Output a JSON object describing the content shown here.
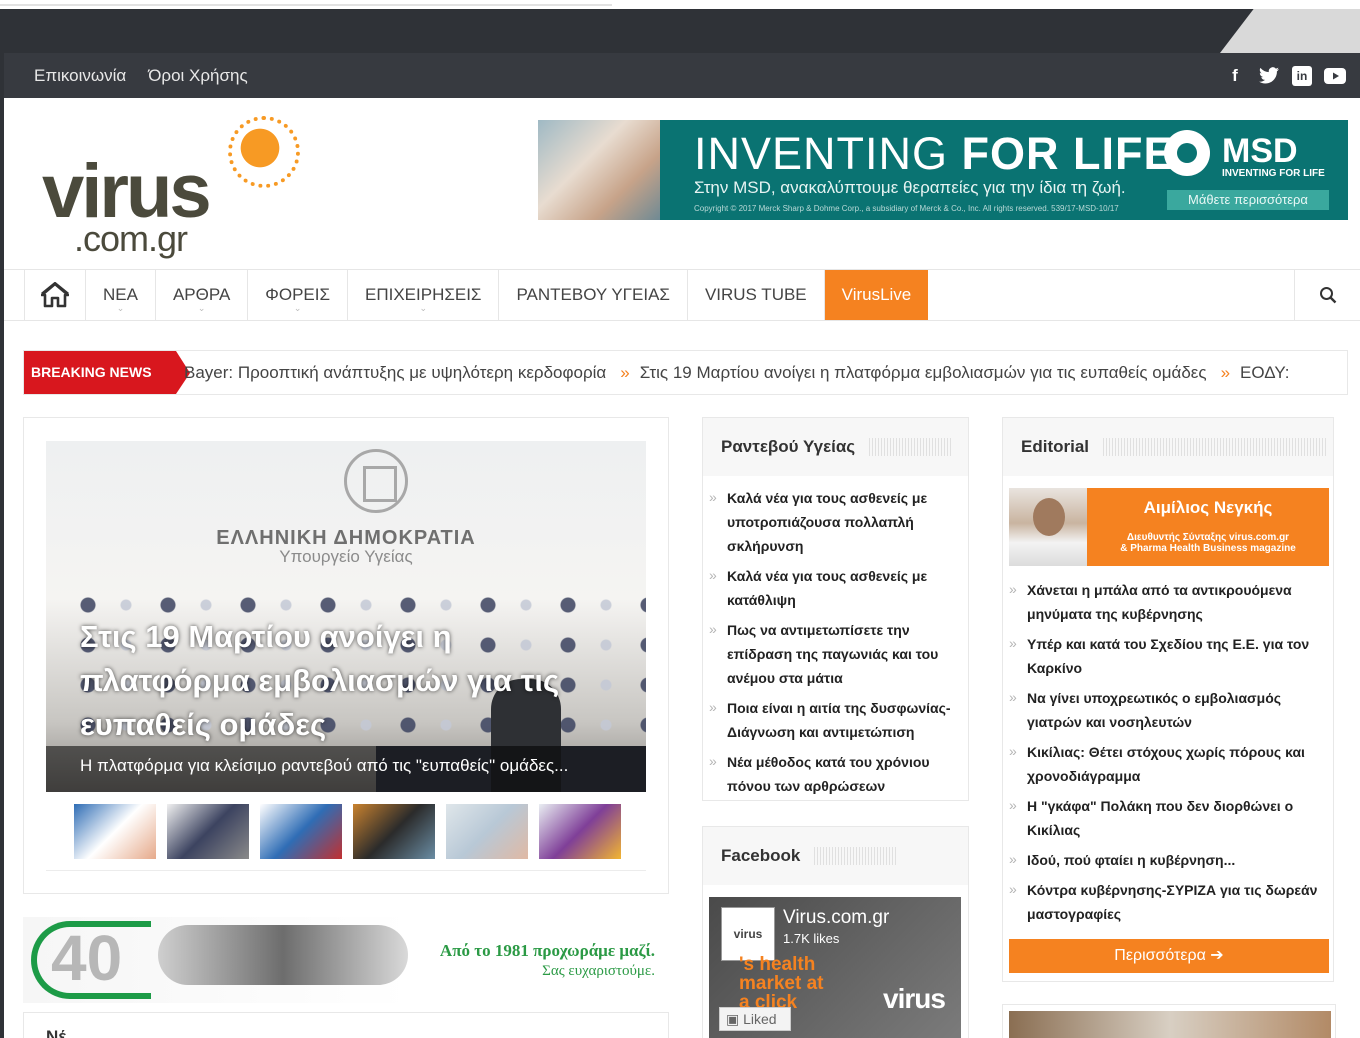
{
  "topbar": {
    "links": [
      "Επικοινωνία",
      "Όροι Χρήσης"
    ],
    "social_icons": [
      "facebook-icon",
      "twitter-icon",
      "linkedin-icon",
      "youtube-icon"
    ]
  },
  "logo": {
    "word": "virus",
    "domain": ".com.gr"
  },
  "banner": {
    "title_light": "INVENTING ",
    "title_bold": "FOR LIFE",
    "subtitle": "Στην MSD, ανακαλύπτουμε θεραπείες για την ίδια τη ζωή.",
    "copyright": "Copyright © 2017 Merck Sharp & Dohme Corp., a subsidiary of Merck & Co., Inc. All rights reserved. 539/17-MSD-10/17",
    "brand": "MSD",
    "brand_tag": "INVENTING FOR LIFE",
    "button": "Μάθετε περισσότερα"
  },
  "nav": {
    "items": [
      "ΝΕΑ",
      "ΑΡΘΡΑ",
      "ΦΟΡΕΙΣ",
      "ΕΠΙΧΕΙΡΗΣΕΙΣ",
      "ΡΑΝΤΕΒΟΥ ΥΓΕΙΑΣ",
      "VIRUS TUBE"
    ],
    "live": "VirusLive"
  },
  "breaking": {
    "label": "BREAKING NEWS",
    "items": [
      "Bayer: Προοπτική ανάπτυξης με υψηλότερη κερδοφορία",
      "Στις 19 Μαρτίου ανοίγει η πλατφόρμα εμβολιασμών για τις ευπαθείς ομάδες",
      "ΕΟΔΥ:"
    ]
  },
  "featured": {
    "image_text_line1": "ΕΛΛΗΝΙΚΗ ΔΗΜΟΚΡΑΤΙΑ",
    "image_text_line2": "Υπουργείο Υγείας",
    "headline": "Στις 19 Μαρτίου ανοίγει η πλατφόρμα εμβολιασμών για τις ευπαθείς ομάδες",
    "caption": "Η πλατφόρμα για κλείσιμο ραντεβού από τις \"ευπαθείς\" ομάδες..."
  },
  "thumbnails": [
    {
      "name": "thumb-greek-flag-vaccine",
      "colors": [
        "#2f6db5",
        "#ffffff",
        "#e6a98a"
      ]
    },
    {
      "name": "thumb-press-conference",
      "colors": [
        "#f0f0f0",
        "#3c4360",
        "#8a8a8a"
      ]
    },
    {
      "name": "thumb-greek-globe-vaccine",
      "colors": [
        "#ffffff",
        "#2f6db5",
        "#c23030"
      ]
    },
    {
      "name": "thumb-vaccine-vials",
      "colors": [
        "#c9822f",
        "#2b2b2b",
        "#6a8da4"
      ]
    },
    {
      "name": "thumb-vaccination",
      "colors": [
        "#dfe6ea",
        "#b8c8d6",
        "#e0b9a4"
      ]
    },
    {
      "name": "thumb-astrazeneca",
      "colors": [
        "#e9eef2",
        "#7f3f98",
        "#f2b531"
      ]
    }
  ],
  "promo40": {
    "number": "40",
    "line1": "Από το 1981 προχωράμε μαζί.",
    "line2": "Σας ευχαριστούμε."
  },
  "lower_stub_title": "Νέ",
  "appointments": {
    "title": "Ραντεβού Υγείας",
    "items": [
      "Καλά νέα για τους ασθενείς με υποτροπιάζουσα πολλαπλή σκλήρυνση",
      "Καλά νέα για τους ασθενείς με κατάθλιψη",
      "Πως να αντιμετωπίσετε την επίδραση της παγωνιάς και του ανέμου στα μάτια",
      "Ποια είναι η αιτία της δυσφωνίας- Διάγνωση και αντιμετώπιση",
      "Νέα μέθοδος κατά του χρόνιου πόνου των αρθρώσεων"
    ]
  },
  "facebook": {
    "title": "Facebook",
    "page_name": "Virus.com.gr",
    "likes": "1.7K likes",
    "avatar_text": "virus",
    "slogan": "'s health market at a click ouse!",
    "logo_text": "virus",
    "liked_button": "Liked"
  },
  "editorial": {
    "title": "Editorial",
    "author": "Αιμίλιος Νεγκής",
    "role_line1": "Διευθυντής Σύνταξης virus.com.gr",
    "role_line2": "& Pharma Health Business magazine",
    "items": [
      "Χάνεται η μπάλα από τα αντικρουόμενα μηνύματα της κυβέρνησης",
      "Υπέρ και κατά του Σχεδίου της Ε.Ε. για τον Καρκίνο",
      "Να γίνει υποχρεωτικός ο εμβολιασμός γιατρών και νοσηλευτών",
      "Κικίλιας: Θέτει στόχους χωρίς πόρους και χρονοδιάγραμμα",
      "Η \"γκάφα\" Πολάκη που δεν διορθώνει ο Κικίλιας",
      "Ιδού, πού φταίει η κυβέρνηση...",
      "Κόντρα κυβέρνησης-ΣΥΡΙΖΑ για τις δωρεάν μαστογραφίες"
    ],
    "more_button": "Περισσότερα ➔"
  },
  "colors": {
    "accent": "#f58220",
    "breaking_red": "#d8171e",
    "topbar_dark": "#373a40",
    "banner_teal": "#0a7372"
  }
}
